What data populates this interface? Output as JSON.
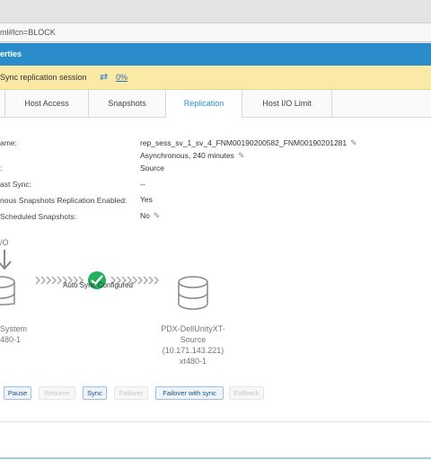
{
  "browser": {
    "url_fragment": "ml#lcn=BLOCK"
  },
  "dialog": {
    "title": "erties",
    "banner": {
      "message": "Sync replication session",
      "percent": "0%"
    },
    "tabs": [
      {
        "label": "Host Access"
      },
      {
        "label": "Snapshots"
      },
      {
        "label": "Replication"
      },
      {
        "label": "Host I/O Limit"
      }
    ],
    "fields": [
      {
        "label": "ame:",
        "value": "rep_sess_sv_1_sv_4_FNM00190200582_FNM00190201281"
      },
      {
        "label": "",
        "value": "Asynchronous, 240 minutes"
      },
      {
        "label": ":",
        "value": "Source"
      },
      {
        "label": "ast Sync:",
        "value": "--"
      },
      {
        "label": "nous Snapshots Replication Enabled:",
        "value": "Yes"
      },
      {
        "label": "Scheduled Snapshots:",
        "value": "No"
      }
    ],
    "diagram": {
      "io_label": "/O",
      "status_label": "Auto Sync Configured",
      "left_system": [
        "System",
        "480-1"
      ],
      "right_system": [
        "PDX-DellUnityXT-",
        "Source",
        "(10.171.143.221)",
        "xt480-1"
      ]
    },
    "buttons": [
      {
        "label": "Pause"
      },
      {
        "label": "Resume"
      },
      {
        "label": "Sync"
      },
      {
        "label": "Failover"
      },
      {
        "label": "Failover with sync"
      },
      {
        "label": "Failback"
      }
    ],
    "colors": {
      "title_bar": "#2b8ccb",
      "banner": "#fbe9a6",
      "status_ok": "#22b05a"
    }
  }
}
